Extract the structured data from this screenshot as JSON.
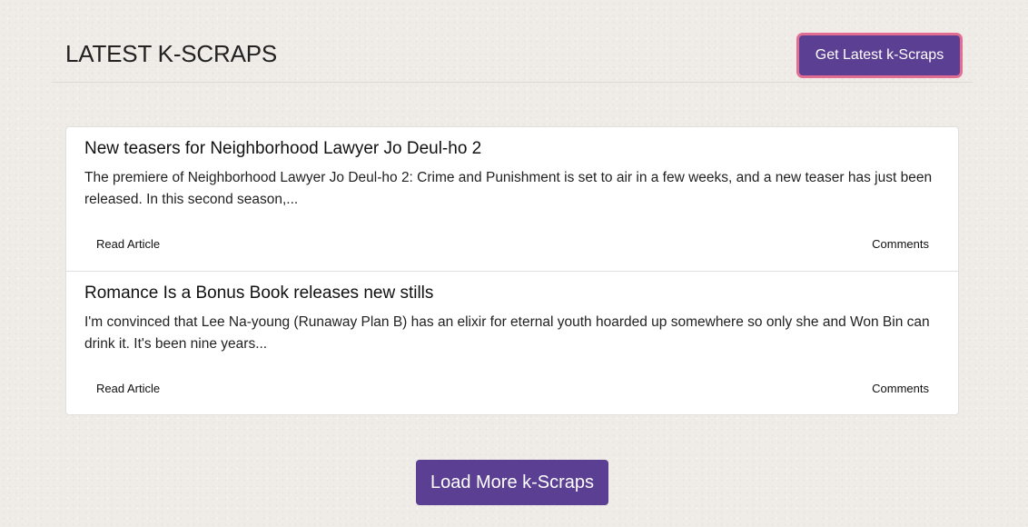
{
  "header": {
    "title": "LATEST K-SCRAPS",
    "get_latest_label": "Get Latest k-Scraps"
  },
  "articles": [
    {
      "title": "New teasers for Neighborhood Lawyer Jo Deul-ho 2",
      "excerpt": "The premiere of Neighborhood Lawyer Jo Deul-ho 2: Crime and Punishment is set to air in a few weeks, and a new teaser has just been released. In this second season,...",
      "read_label": "Read Article",
      "comments_label": "Comments"
    },
    {
      "title": "Romance Is a Bonus Book releases new stills",
      "excerpt": "I'm convinced that Lee Na-young (Runaway Plan B) has an elixir for eternal youth hoarded up somewhere so only she and Won Bin can drink it. It's been nine years...",
      "read_label": "Read Article",
      "comments_label": "Comments"
    }
  ],
  "footer": {
    "load_more_label": "Load More k-Scraps"
  },
  "colors": {
    "accent": "#5a3f93",
    "focus_ring": "#e26d92",
    "background": "#efece8"
  }
}
